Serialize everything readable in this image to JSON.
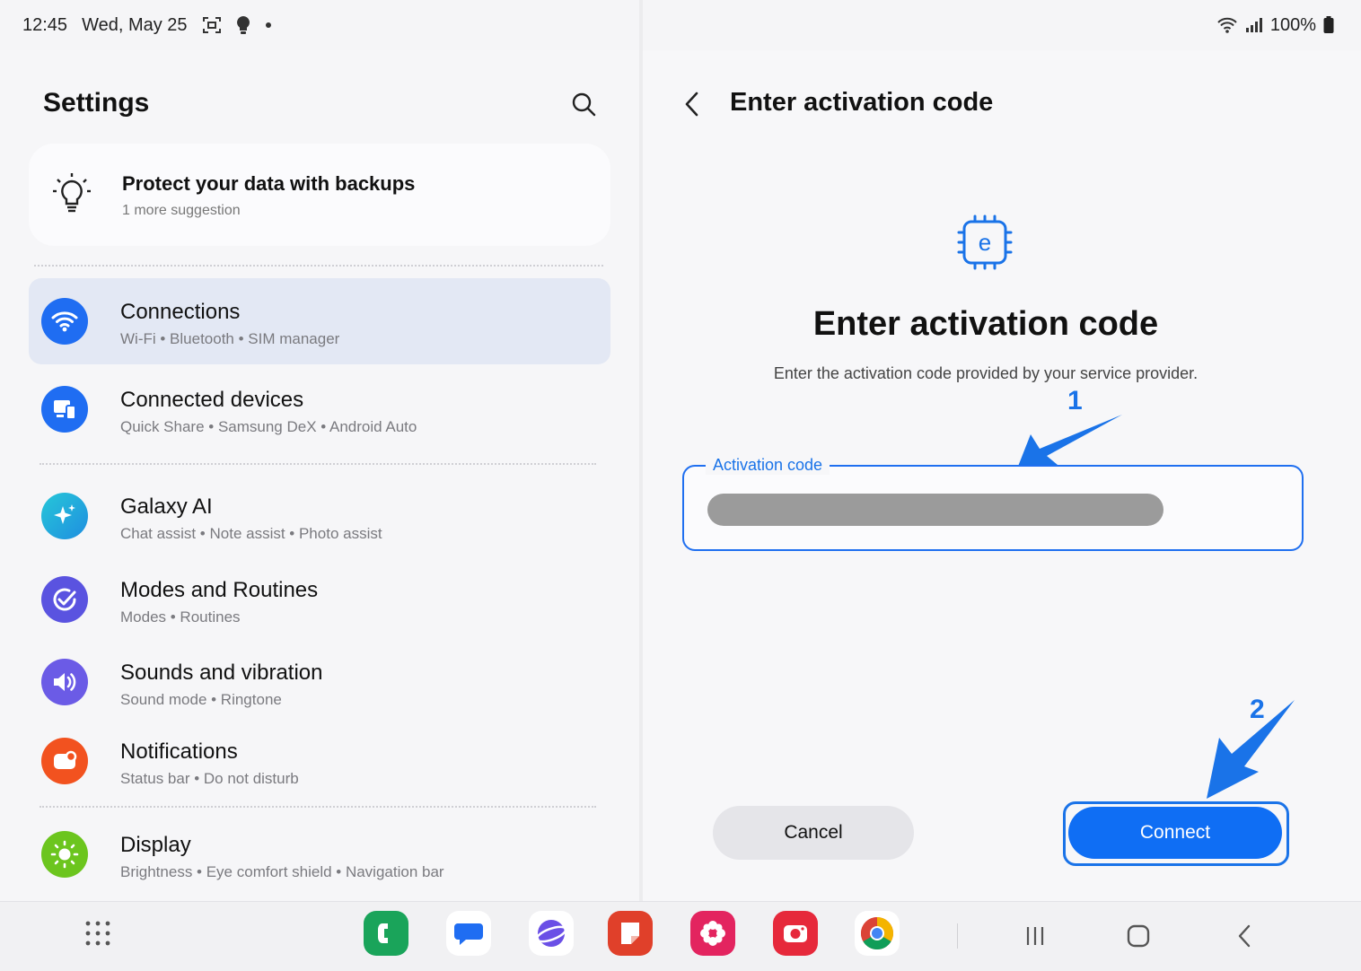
{
  "status": {
    "time": "12:45",
    "date": "Wed, May 25",
    "battery": "100%"
  },
  "settings": {
    "title": "Settings",
    "suggestion": {
      "title": "Protect your data with backups",
      "subtitle": "1 more suggestion"
    },
    "items": [
      {
        "title": "Connections",
        "subtitle": "Wi-Fi  •  Bluetooth  •  SIM manager",
        "icon": "wifi-icon",
        "color": "#1f6df2",
        "selected": true
      },
      {
        "title": "Connected devices",
        "subtitle": "Quick Share  •  Samsung DeX  •  Android Auto",
        "icon": "devices-icon",
        "color": "#1f6df2"
      },
      {
        "title": "Galaxy AI",
        "subtitle": "Chat assist  •  Note assist  •  Photo assist",
        "icon": "sparkle-icon",
        "color": "#1fb4d6"
      },
      {
        "title": "Modes and Routines",
        "subtitle": "Modes  •  Routines",
        "icon": "check-circle-icon",
        "color": "#5a53e0"
      },
      {
        "title": "Sounds and vibration",
        "subtitle": "Sound mode  •  Ringtone",
        "icon": "speaker-icon",
        "color": "#6b5be6"
      },
      {
        "title": "Notifications",
        "subtitle": "Status bar  •  Do not disturb",
        "icon": "notification-icon",
        "color": "#f2521f"
      },
      {
        "title": "Display",
        "subtitle": "Brightness  •  Eye comfort shield  •  Navigation bar",
        "icon": "sun-icon",
        "color": "#6cc51e"
      }
    ]
  },
  "activation": {
    "header": "Enter activation code",
    "heading": "Enter activation code",
    "description": "Enter the activation code provided by your service provider.",
    "field_label": "Activation code",
    "cancel": "Cancel",
    "connect": "Connect",
    "annotation_1": "1",
    "annotation_2": "2"
  },
  "colors": {
    "accent": "#1a73e8",
    "connect_bg": "#0f6ef4"
  },
  "dock": {
    "apps": [
      "phone-app-icon",
      "messages-app-icon",
      "internet-app-icon",
      "notes-app-icon",
      "gallery-app-icon",
      "camera-app-icon",
      "chrome-app-icon"
    ]
  }
}
